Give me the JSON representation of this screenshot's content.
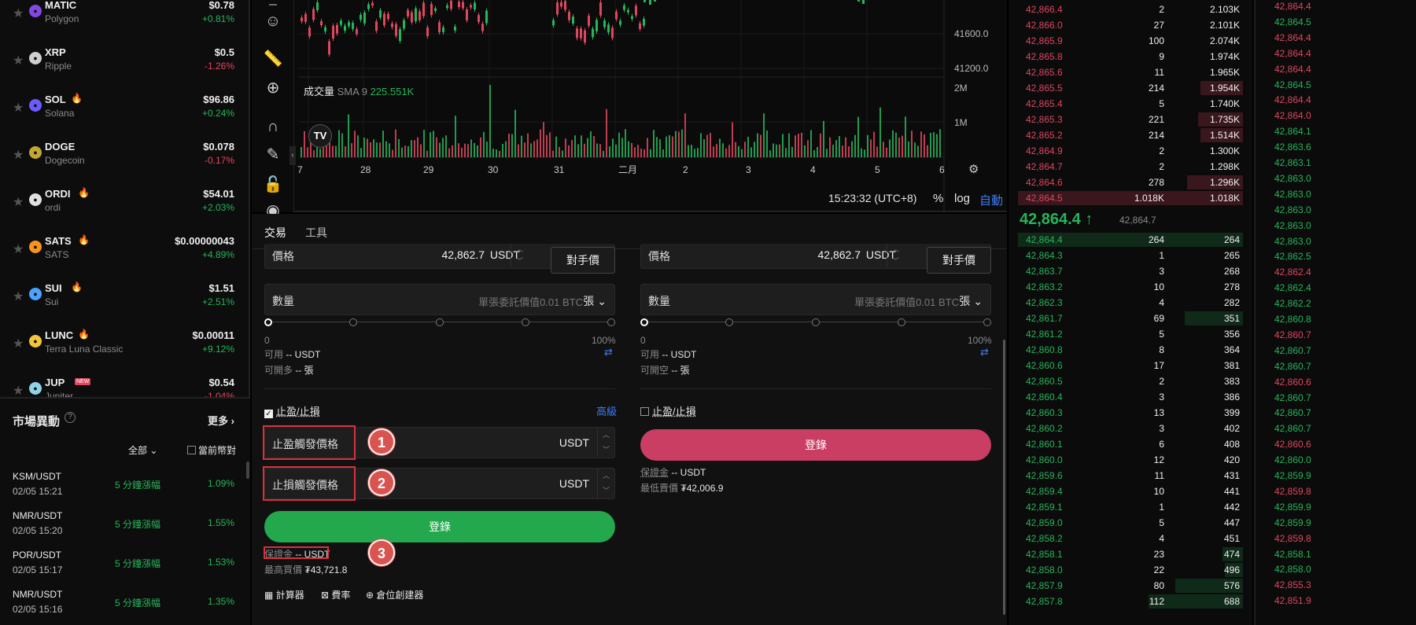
{
  "coins": [
    {
      "symbol": "MATIC",
      "name": "Polygon",
      "price": "$0.78",
      "change": "+0.81%",
      "dir": "up",
      "hot": false,
      "new": false,
      "icon_color": "#8247e5",
      "icon": "polygon-icon"
    },
    {
      "symbol": "XRP",
      "name": "Ripple",
      "price": "$0.5",
      "change": "-1.26%",
      "dir": "down",
      "hot": false,
      "new": false,
      "icon_color": "#cfcfcf",
      "icon": "xrp-icon"
    },
    {
      "symbol": "SOL",
      "name": "Solana",
      "price": "$96.86",
      "change": "+0.24%",
      "dir": "up",
      "hot": true,
      "new": false,
      "icon_color": "#6b5cff",
      "icon": "solana-icon"
    },
    {
      "symbol": "DOGE",
      "name": "Dogecoin",
      "price": "$0.078",
      "change": "-0.17%",
      "dir": "down",
      "hot": false,
      "new": false,
      "icon_color": "#c2a633",
      "icon": "dogecoin-icon"
    },
    {
      "symbol": "ORDI",
      "name": "ordi",
      "price": "$54.01",
      "change": "+2.03%",
      "dir": "up",
      "hot": true,
      "new": false,
      "icon_color": "#e0e0e0",
      "icon": "ordi-icon"
    },
    {
      "symbol": "SATS",
      "name": "SATS",
      "price": "$0.00000043",
      "change": "+4.89%",
      "dir": "up",
      "hot": true,
      "new": false,
      "icon_color": "#f7931a",
      "icon": "sats-icon"
    },
    {
      "symbol": "SUI",
      "name": "Sui",
      "price": "$1.51",
      "change": "+2.51%",
      "dir": "up",
      "hot": true,
      "new": false,
      "icon_color": "#4da2ff",
      "icon": "sui-icon"
    },
    {
      "symbol": "LUNC",
      "name": "Terra Luna Classic",
      "price": "$0.00011",
      "change": "+9.12%",
      "dir": "up",
      "hot": true,
      "new": false,
      "icon_color": "#f4c53b",
      "icon": "lunc-icon"
    },
    {
      "symbol": "JUP",
      "name": "Jupiter",
      "price": "$0.54",
      "change": "-1.04%",
      "dir": "down",
      "hot": false,
      "new": true,
      "icon_color": "#8fd3e8",
      "icon": "jupiter-icon"
    }
  ],
  "market": {
    "title": "市場異動",
    "more": "更多",
    "filter": "全部",
    "current_only": "當前幣對",
    "rows": [
      {
        "pair": "KSM/USDT",
        "time": "02/05 15:21",
        "kind": "5 分鐘漲幅",
        "value": "1.09%"
      },
      {
        "pair": "NMR/USDT",
        "time": "02/05 15:20",
        "kind": "5 分鐘漲幅",
        "value": "1.55%"
      },
      {
        "pair": "POR/USDT",
        "time": "02/05 15:17",
        "kind": "5 分鐘漲幅",
        "value": "1.53%"
      },
      {
        "pair": "NMR/USDT",
        "time": "02/05 15:16",
        "kind": "5 分鐘漲幅",
        "value": "1.35%"
      }
    ]
  },
  "chart": {
    "price_ticks": [
      "41600.0",
      "41200.0"
    ],
    "volume_ticks": [
      "2M",
      "1M"
    ],
    "volume_label": "成交量",
    "sma_label": "SMA 9",
    "sma_value": "225.551K",
    "date_ticks": [
      "7",
      "28",
      "29",
      "30",
      "31",
      "二月",
      "2",
      "3",
      "4",
      "5",
      "6"
    ],
    "clock": "15:23:32 (UTC+8)",
    "percent": "%",
    "log": "log",
    "auto": "自動",
    "colors": {
      "up": "#26b55a",
      "down": "#e0465e"
    }
  },
  "trade": {
    "tabs": [
      "交易",
      "工具"
    ],
    "price_label": "價格",
    "price_value": "42,862.7",
    "unit": "USDT",
    "counter_price": "對手價",
    "qty_label": "數量",
    "qty_placeholder": "單張委託價值0.01 BTC",
    "qty_unit": "張",
    "slider_min": "0",
    "slider_max": "100%",
    "available": "可用",
    "available_value": "-- USDT",
    "open_long": "可開多",
    "open_short": "可開空",
    "open_value": "-- 張",
    "tpsl": "止盈/止損",
    "advanced": "高級",
    "tp_trigger": "止盈觸發價格",
    "sl_trigger": "止損觸發價格",
    "login": "登錄",
    "margin": "保證金",
    "margin_value": "-- USDT",
    "max_buy": "最高買價",
    "max_buy_value": "₮43,721.8",
    "min_sell": "最低賣價",
    "min_sell_value": "₮42,006.9",
    "calculator": "計算器",
    "fee_rate": "費率",
    "position_builder": "倉位創建器",
    "markers": [
      "1",
      "2",
      "3"
    ],
    "buy_color": "#23a84d",
    "sell_color": "#c93e62"
  },
  "orderbook": {
    "asks": [
      {
        "price": "42,866.4",
        "qty": "2",
        "total": "2.103K",
        "depth": 0.0
      },
      {
        "price": "42,866.0",
        "qty": "27",
        "total": "2.101K",
        "depth": 0.0
      },
      {
        "price": "42,865.9",
        "qty": "100",
        "total": "2.074K",
        "depth": 0.0
      },
      {
        "price": "42,865.8",
        "qty": "9",
        "total": "1.974K",
        "depth": 0.0
      },
      {
        "price": "42,865.6",
        "qty": "11",
        "total": "1.965K",
        "depth": 0.0
      },
      {
        "price": "42,865.5",
        "qty": "214",
        "total": "1.954K",
        "depth": 0.19
      },
      {
        "price": "42,865.4",
        "qty": "5",
        "total": "1.740K",
        "depth": 0.0
      },
      {
        "price": "42,865.3",
        "qty": "221",
        "total": "1.735K",
        "depth": 0.2
      },
      {
        "price": "42,865.2",
        "qty": "214",
        "total": "1.514K",
        "depth": 0.19
      },
      {
        "price": "42,864.9",
        "qty": "2",
        "total": "1.300K",
        "depth": 0.0
      },
      {
        "price": "42,864.7",
        "qty": "2",
        "total": "1.298K",
        "depth": 0.0
      },
      {
        "price": "42,864.6",
        "qty": "278",
        "total": "1.296K",
        "depth": 0.25
      },
      {
        "price": "42,864.5",
        "qty": "1.018K",
        "total": "1.018K",
        "depth": 1.0
      }
    ],
    "last_price": "42,864.4",
    "mark_price": "42,864.7",
    "bids": [
      {
        "price": "42,864.4",
        "qty": "264",
        "total": "264",
        "depth": 1.0
      },
      {
        "price": "42,864.3",
        "qty": "1",
        "total": "265",
        "depth": 0.0
      },
      {
        "price": "42,863.7",
        "qty": "3",
        "total": "268",
        "depth": 0.0
      },
      {
        "price": "42,863.2",
        "qty": "10",
        "total": "278",
        "depth": 0.0
      },
      {
        "price": "42,862.3",
        "qty": "4",
        "total": "282",
        "depth": 0.0
      },
      {
        "price": "42,861.7",
        "qty": "69",
        "total": "351",
        "depth": 0.26
      },
      {
        "price": "42,861.2",
        "qty": "5",
        "total": "356",
        "depth": 0.0
      },
      {
        "price": "42,860.8",
        "qty": "8",
        "total": "364",
        "depth": 0.0
      },
      {
        "price": "42,860.6",
        "qty": "17",
        "total": "381",
        "depth": 0.0
      },
      {
        "price": "42,860.5",
        "qty": "2",
        "total": "383",
        "depth": 0.0
      },
      {
        "price": "42,860.4",
        "qty": "3",
        "total": "386",
        "depth": 0.0
      },
      {
        "price": "42,860.3",
        "qty": "13",
        "total": "399",
        "depth": 0.0
      },
      {
        "price": "42,860.2",
        "qty": "3",
        "total": "402",
        "depth": 0.0
      },
      {
        "price": "42,860.1",
        "qty": "6",
        "total": "408",
        "depth": 0.0
      },
      {
        "price": "42,860.0",
        "qty": "12",
        "total": "420",
        "depth": 0.0
      },
      {
        "price": "42,859.6",
        "qty": "11",
        "total": "431",
        "depth": 0.0
      },
      {
        "price": "42,859.4",
        "qty": "10",
        "total": "441",
        "depth": 0.0
      },
      {
        "price": "42,859.1",
        "qty": "1",
        "total": "442",
        "depth": 0.0
      },
      {
        "price": "42,859.0",
        "qty": "5",
        "total": "447",
        "depth": 0.0
      },
      {
        "price": "42,858.2",
        "qty": "4",
        "total": "451",
        "depth": 0.0
      },
      {
        "price": "42,858.1",
        "qty": "23",
        "total": "474",
        "depth": 0.09
      },
      {
        "price": "42,858.0",
        "qty": "22",
        "total": "496",
        "depth": 0.08
      },
      {
        "price": "42,857.9",
        "qty": "80",
        "total": "576",
        "depth": 0.3
      },
      {
        "price": "42,857.8",
        "qty": "112",
        "total": "688",
        "depth": 0.42
      }
    ]
  },
  "trades": [
    {
      "price": "42,864.4",
      "dir": "down"
    },
    {
      "price": "42,864.5",
      "dir": "up"
    },
    {
      "price": "42,864.4",
      "dir": "down"
    },
    {
      "price": "42,864.4",
      "dir": "down"
    },
    {
      "price": "42,864.4",
      "dir": "down"
    },
    {
      "price": "42,864.5",
      "dir": "up"
    },
    {
      "price": "42,864.4",
      "dir": "down"
    },
    {
      "price": "42,864.0",
      "dir": "down"
    },
    {
      "price": "42,864.1",
      "dir": "up"
    },
    {
      "price": "42,863.6",
      "dir": "up"
    },
    {
      "price": "42,863.1",
      "dir": "up"
    },
    {
      "price": "42,863.0",
      "dir": "up"
    },
    {
      "price": "42,863.0",
      "dir": "up"
    },
    {
      "price": "42,863.0",
      "dir": "up"
    },
    {
      "price": "42,863.0",
      "dir": "up"
    },
    {
      "price": "42,863.0",
      "dir": "up"
    },
    {
      "price": "42,862.5",
      "dir": "up"
    },
    {
      "price": "42,862.4",
      "dir": "down"
    },
    {
      "price": "42,862.4",
      "dir": "up"
    },
    {
      "price": "42,862.2",
      "dir": "up"
    },
    {
      "price": "42,860.8",
      "dir": "up"
    },
    {
      "price": "42,860.7",
      "dir": "down"
    },
    {
      "price": "42,860.7",
      "dir": "up"
    },
    {
      "price": "42,860.7",
      "dir": "up"
    },
    {
      "price": "42,860.6",
      "dir": "down"
    },
    {
      "price": "42,860.7",
      "dir": "up"
    },
    {
      "price": "42,860.7",
      "dir": "up"
    },
    {
      "price": "42,860.7",
      "dir": "up"
    },
    {
      "price": "42,860.6",
      "dir": "down"
    },
    {
      "price": "42,860.0",
      "dir": "up"
    },
    {
      "price": "42,859.9",
      "dir": "up"
    },
    {
      "price": "42,859.8",
      "dir": "down"
    },
    {
      "price": "42,859.9",
      "dir": "up"
    },
    {
      "price": "42,859.9",
      "dir": "up"
    },
    {
      "price": "42,859.8",
      "dir": "down"
    },
    {
      "price": "42,858.1",
      "dir": "up"
    },
    {
      "price": "42,858.0",
      "dir": "up"
    },
    {
      "price": "42,855.3",
      "dir": "down"
    },
    {
      "price": "42,851.9",
      "dir": "down"
    }
  ]
}
